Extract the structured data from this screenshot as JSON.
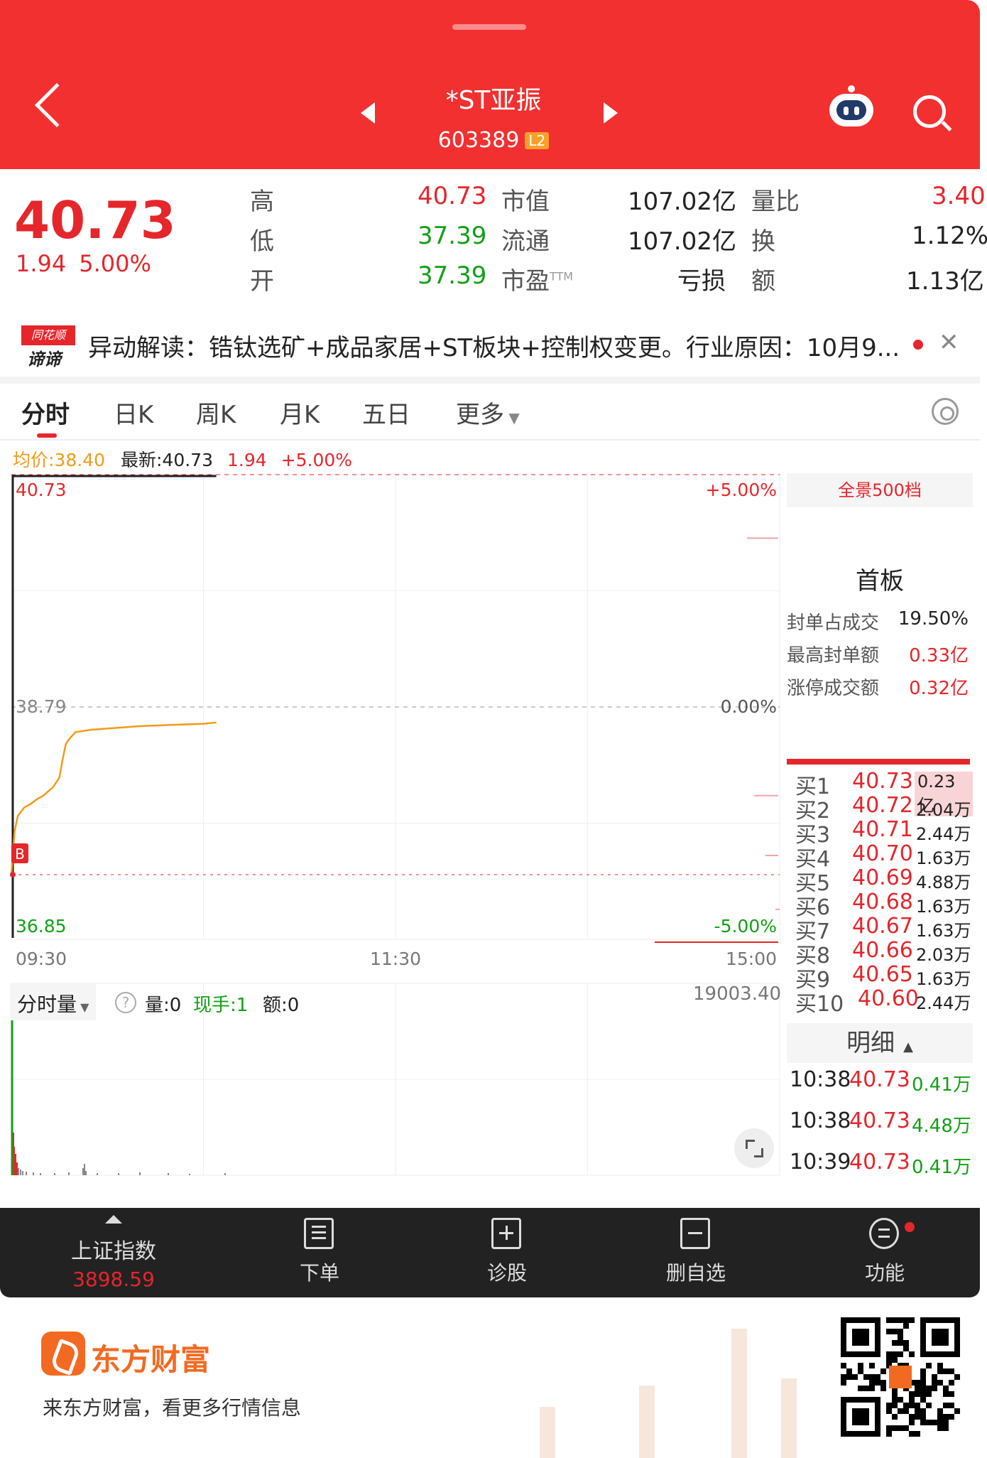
{
  "header": {
    "title": "*ST亚振",
    "code": "603389",
    "level_badge": "L2"
  },
  "quote": {
    "price": "40.73",
    "change": "1.94",
    "change_pct": "5.00%",
    "rows": [
      {
        "l1": "高",
        "v1": "40.73",
        "l2": "市值",
        "v2": "107.02亿",
        "l3": "量比",
        "v3": "3.40"
      },
      {
        "l1": "低",
        "v1": "37.39",
        "l2": "流通",
        "v2": "107.02亿",
        "l3": "换",
        "v3": "1.12%"
      },
      {
        "l1": "开",
        "v1": "37.39",
        "l2": "市盈",
        "l2_sup": "TTM",
        "v2": "亏损",
        "l3": "额",
        "v3": "1.13亿"
      }
    ]
  },
  "news": {
    "logo_top": "同花顺",
    "logo_bottom": "谛谛",
    "text": "异动解读：锆钛选矿+成品家居+ST板块+控制权变更。行业原因：10月9..."
  },
  "tabs": [
    "分时",
    "日K",
    "周K",
    "月K",
    "五日",
    "更多"
  ],
  "chart_info": {
    "avg": "均价:38.40",
    "latest": "最新:40.73",
    "chg": "1.94",
    "pct": "+5.00%"
  },
  "chart_data": {
    "type": "line",
    "prev_close": 38.79,
    "ylim": [
      36.85,
      40.73
    ],
    "y_labels": {
      "top": "40.73",
      "mid": "38.79",
      "bottom": "36.85"
    },
    "pct_labels": {
      "top": "+5.00%",
      "mid": "0.00%",
      "bottom": "-5.00%"
    },
    "x_labels": [
      "09:30",
      "11:30",
      "15:00"
    ],
    "buy_marker": "B",
    "series": [
      {
        "values": [
          [
            0,
            37.39
          ],
          [
            1,
            37.75
          ],
          [
            2,
            37.88
          ],
          [
            4,
            37.95
          ],
          [
            6,
            37.98
          ],
          [
            8,
            38.02
          ],
          [
            10,
            38.05
          ],
          [
            13,
            38.12
          ],
          [
            15,
            38.2
          ],
          [
            16,
            38.35
          ],
          [
            17,
            38.48
          ],
          [
            18,
            38.52
          ],
          [
            20,
            38.58
          ],
          [
            25,
            38.6
          ],
          [
            30,
            38.61
          ],
          [
            40,
            38.63
          ],
          [
            50,
            38.64
          ],
          [
            60,
            38.65
          ],
          [
            64,
            38.66
          ]
        ]
      }
    ]
  },
  "right_panel": {
    "button": "全景500档",
    "board_title": "首板",
    "stats": [
      {
        "k": "封单占成交",
        "v": "19.50%",
        "color": "#222222"
      },
      {
        "k": "最高封单额",
        "v": "0.33亿",
        "color": "#e5262b"
      },
      {
        "k": "涨停成交额",
        "v": "0.32亿",
        "color": "#e5262b"
      }
    ],
    "book": [
      {
        "k": "买1",
        "p": "40.73",
        "v": "0.23亿"
      },
      {
        "k": "买2",
        "p": "40.72",
        "v": "2.04万"
      },
      {
        "k": "买3",
        "p": "40.71",
        "v": "2.44万"
      },
      {
        "k": "买4",
        "p": "40.70",
        "v": "1.63万"
      },
      {
        "k": "买5",
        "p": "40.69",
        "v": "4.88万"
      },
      {
        "k": "买6",
        "p": "40.68",
        "v": "1.63万"
      },
      {
        "k": "买7",
        "p": "40.67",
        "v": "1.63万"
      },
      {
        "k": "买8",
        "p": "40.66",
        "v": "2.03万"
      },
      {
        "k": "买9",
        "p": "40.65",
        "v": "1.63万"
      },
      {
        "k": "买10",
        "p": "40.60",
        "v": "2.44万"
      }
    ],
    "detail_label": "明细",
    "ticks": [
      {
        "t": "10:38",
        "p": "40.73",
        "v": "0.41万"
      },
      {
        "t": "10:38",
        "p": "40.73",
        "v": "4.48万"
      },
      {
        "t": "10:39",
        "p": "40.73",
        "v": "0.41万"
      }
    ]
  },
  "volume": {
    "selector": "分时量",
    "help": "?",
    "vol": "量:0",
    "hand": "现手:1",
    "amount": "额:0",
    "max": "19003.40"
  },
  "nav": {
    "index_name": "上证指数",
    "index_value": "3898.59",
    "items": [
      "下单",
      "诊股",
      "删自选",
      "功能"
    ]
  },
  "footer": {
    "brand": "东方财富",
    "slogan": "来东方财富，看更多行情信息"
  },
  "colors": {
    "header": "#f23030",
    "up": "#e5262b",
    "down": "#13a016",
    "avg_line": "#f19a1d"
  }
}
